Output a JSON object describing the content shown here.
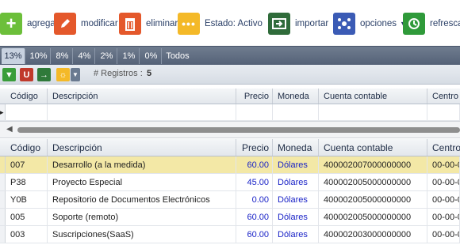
{
  "toolbar": {
    "agregar": "agregar",
    "modificar": "modificar",
    "eliminar": "eliminar",
    "estado": "Estado: Activo",
    "importar": "importar",
    "opciones": "opciones",
    "refrescar": "refrescar"
  },
  "rates": [
    "13%",
    "10%",
    "8%",
    "4%",
    "2%",
    "1%",
    "0%",
    "Todos"
  ],
  "subbar": {
    "registros_label": "# Registros :",
    "registros_count": "5"
  },
  "columns": [
    "Código",
    "Descripción",
    "Precio",
    "Moneda",
    "Cuenta contable",
    "Centro"
  ],
  "rows": [
    {
      "codigo": "007",
      "descripcion": "Desarrollo (a la medida)",
      "precio": "60.00",
      "moneda": "Dólares",
      "cuenta": "400002007000000000",
      "centro": "00-00-0"
    },
    {
      "codigo": "P38",
      "descripcion": "Proyecto Especial",
      "precio": "45.00",
      "moneda": "Dólares",
      "cuenta": "400002005000000000",
      "centro": "00-00-0"
    },
    {
      "codigo": "Y0B",
      "descripcion": "Repositorio de Documentos Electrónicos",
      "precio": "0.00",
      "moneda": "Dólares",
      "cuenta": "400002005000000000",
      "centro": "00-00-0"
    },
    {
      "codigo": "005",
      "descripcion": "Soporte (remoto)",
      "precio": "60.00",
      "moneda": "Dólares",
      "cuenta": "400002005000000000",
      "centro": "00-00-0"
    },
    {
      "codigo": "003",
      "descripcion": "Suscripciones(SaaS)",
      "precio": "60.00",
      "moneda": "Dólares",
      "cuenta": "400002003000000000",
      "centro": "00-00-0"
    }
  ],
  "colors": {
    "accent_green": "#6cbf3a",
    "accent_orange": "#e4582b",
    "accent_yellow": "#f4b928",
    "selected_row": "#f3e8a6",
    "price_blue": "#1a23c7"
  }
}
